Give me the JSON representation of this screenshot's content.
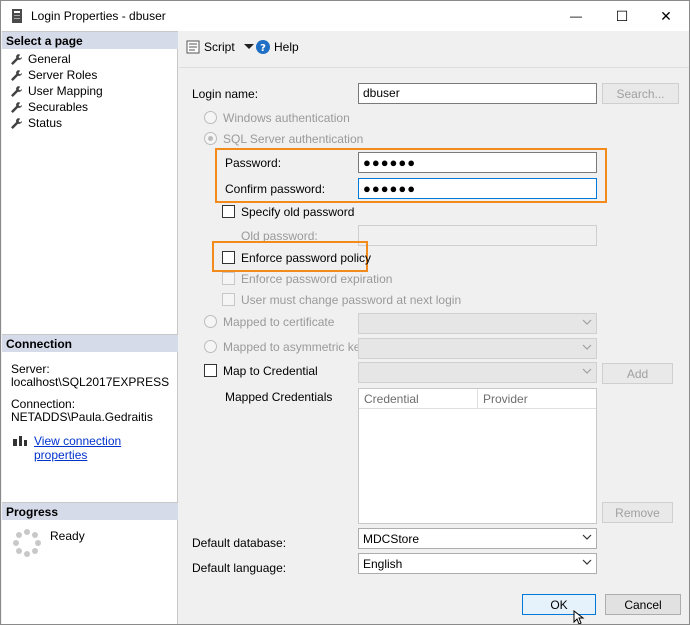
{
  "window": {
    "title": "Login Properties - dbuser",
    "minimize_glyph": "—",
    "maximize_glyph": "☐",
    "close_glyph": "✕"
  },
  "sidebar": {
    "select_page_header": "Select a page",
    "pages": [
      {
        "label": "General",
        "icon": "wrench-icon"
      },
      {
        "label": "Server Roles",
        "icon": "wrench-icon"
      },
      {
        "label": "User Mapping",
        "icon": "wrench-icon"
      },
      {
        "label": "Securables",
        "icon": "wrench-icon"
      },
      {
        "label": "Status",
        "icon": "wrench-icon"
      }
    ],
    "connection_header": "Connection",
    "server_label": "Server:",
    "server_value": "localhost\\SQL2017EXPRESS",
    "connection_label": "Connection:",
    "connection_value": "NETADDS\\Paula.Gedraitis",
    "view_connection_link": "View connection properties",
    "progress_header": "Progress",
    "progress_status": "Ready"
  },
  "toolbar": {
    "script_label": "Script",
    "help_label": "Help"
  },
  "form": {
    "login_name_label": "Login name:",
    "login_name_value": "dbuser",
    "search_button": "Search...",
    "windows_auth_label": "Windows authentication",
    "sql_auth_label": "SQL Server authentication",
    "password_label": "Password:",
    "password_value": "●●●●●●",
    "confirm_password_label": "Confirm password:",
    "confirm_password_value": "●●●●●●",
    "specify_old_password_label": "Specify old password",
    "old_password_label": "Old password:",
    "enforce_policy_label": "Enforce password policy",
    "enforce_expiration_label": "Enforce password expiration",
    "must_change_label": "User must change password at next login",
    "mapped_cert_label": "Mapped to certificate",
    "mapped_asym_label": "Mapped to asymmetric key",
    "map_credential_label": "Map to Credential",
    "add_button": "Add",
    "mapped_credentials_label": "Mapped Credentials",
    "credentials_columns": [
      "Credential",
      "Provider"
    ],
    "remove_button": "Remove",
    "default_database_label": "Default database:",
    "default_database_value": "MDCStore",
    "default_language_label": "Default language:",
    "default_language_value": "English"
  },
  "footer": {
    "ok_button": "OK",
    "cancel_button": "Cancel"
  },
  "colors": {
    "highlight": "#f28a1c",
    "section_header": "#d6dbe9",
    "link": "#0033cc",
    "focus_border": "#0078d7"
  }
}
